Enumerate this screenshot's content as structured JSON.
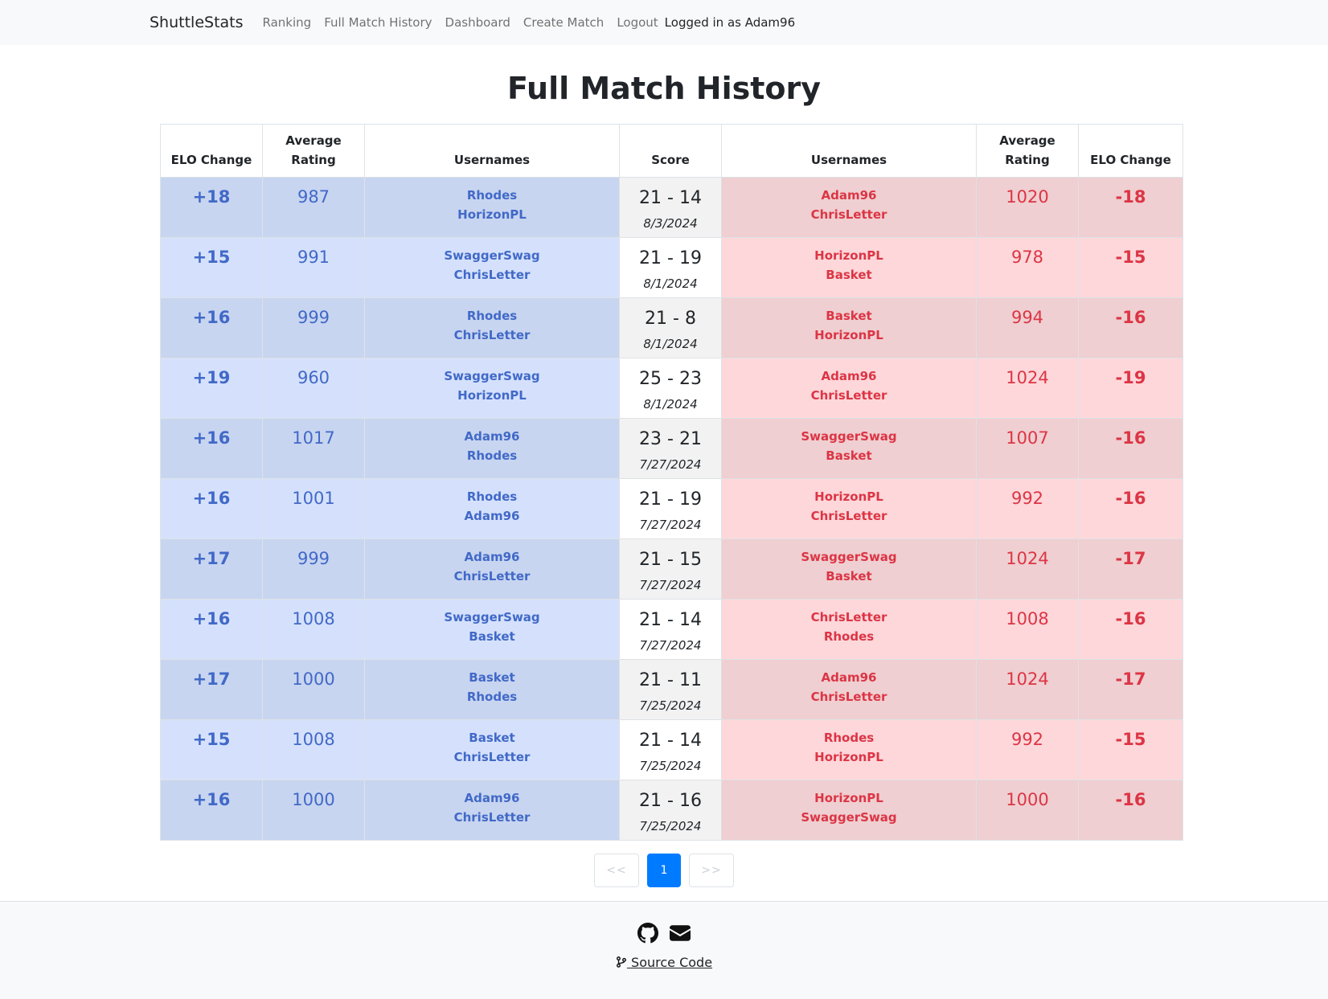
{
  "nav": {
    "brand": "ShuttleStats",
    "links": [
      "Ranking",
      "Full Match History",
      "Dashboard",
      "Create Match",
      "Logout"
    ],
    "user_text": "Logged in as Adam96"
  },
  "page_title": "Full Match History",
  "table": {
    "headers": [
      "ELO Change",
      "Average Rating",
      "Usernames",
      "Score",
      "Usernames",
      "Average Rating",
      "ELO Change"
    ],
    "rows": [
      {
        "win_elo": "+18",
        "win_avg": "987",
        "win_p1": "Rhodes",
        "win_p2": "HorizonPL",
        "score": "21 - 14",
        "date": "8/3/2024",
        "lose_p1": "Adam96",
        "lose_p2": "ChrisLetter",
        "lose_avg": "1020",
        "lose_elo": "-18"
      },
      {
        "win_elo": "+15",
        "win_avg": "991",
        "win_p1": "SwaggerSwag",
        "win_p2": "ChrisLetter",
        "score": "21 - 19",
        "date": "8/1/2024",
        "lose_p1": "HorizonPL",
        "lose_p2": "Basket",
        "lose_avg": "978",
        "lose_elo": "-15"
      },
      {
        "win_elo": "+16",
        "win_avg": "999",
        "win_p1": "Rhodes",
        "win_p2": "ChrisLetter",
        "score": "21 - 8",
        "date": "8/1/2024",
        "lose_p1": "Basket",
        "lose_p2": "HorizonPL",
        "lose_avg": "994",
        "lose_elo": "-16"
      },
      {
        "win_elo": "+19",
        "win_avg": "960",
        "win_p1": "SwaggerSwag",
        "win_p2": "HorizonPL",
        "score": "25 - 23",
        "date": "8/1/2024",
        "lose_p1": "Adam96",
        "lose_p2": "ChrisLetter",
        "lose_avg": "1024",
        "lose_elo": "-19"
      },
      {
        "win_elo": "+16",
        "win_avg": "1017",
        "win_p1": "Adam96",
        "win_p2": "Rhodes",
        "score": "23 - 21",
        "date": "7/27/2024",
        "lose_p1": "SwaggerSwag",
        "lose_p2": "Basket",
        "lose_avg": "1007",
        "lose_elo": "-16"
      },
      {
        "win_elo": "+16",
        "win_avg": "1001",
        "win_p1": "Rhodes",
        "win_p2": "Adam96",
        "score": "21 - 19",
        "date": "7/27/2024",
        "lose_p1": "HorizonPL",
        "lose_p2": "ChrisLetter",
        "lose_avg": "992",
        "lose_elo": "-16"
      },
      {
        "win_elo": "+17",
        "win_avg": "999",
        "win_p1": "Adam96",
        "win_p2": "ChrisLetter",
        "score": "21 - 15",
        "date": "7/27/2024",
        "lose_p1": "SwaggerSwag",
        "lose_p2": "Basket",
        "lose_avg": "1024",
        "lose_elo": "-17"
      },
      {
        "win_elo": "+16",
        "win_avg": "1008",
        "win_p1": "SwaggerSwag",
        "win_p2": "Basket",
        "score": "21 - 14",
        "date": "7/27/2024",
        "lose_p1": "ChrisLetter",
        "lose_p2": "Rhodes",
        "lose_avg": "1008",
        "lose_elo": "-16"
      },
      {
        "win_elo": "+17",
        "win_avg": "1000",
        "win_p1": "Basket",
        "win_p2": "Rhodes",
        "score": "21 - 11",
        "date": "7/25/2024",
        "lose_p1": "Adam96",
        "lose_p2": "ChrisLetter",
        "lose_avg": "1024",
        "lose_elo": "-17"
      },
      {
        "win_elo": "+15",
        "win_avg": "1008",
        "win_p1": "Basket",
        "win_p2": "ChrisLetter",
        "score": "21 - 14",
        "date": "7/25/2024",
        "lose_p1": "Rhodes",
        "lose_p2": "HorizonPL",
        "lose_avg": "992",
        "lose_elo": "-15"
      },
      {
        "win_elo": "+16",
        "win_avg": "1000",
        "win_p1": "Adam96",
        "win_p2": "ChrisLetter",
        "score": "21 - 16",
        "date": "7/25/2024",
        "lose_p1": "HorizonPL",
        "lose_p2": "SwaggerSwag",
        "lose_avg": "1000",
        "lose_elo": "-16"
      }
    ]
  },
  "pagination": {
    "prev": "<<",
    "current": "1",
    "next": ">>"
  },
  "footer": {
    "icons": [
      "github-icon",
      "envelope-icon",
      "git-branch-icon"
    ],
    "source_label": " Source Code"
  },
  "colors": {
    "win": "#4169c8",
    "lose": "#dc3545",
    "active_page": "#007bff"
  }
}
